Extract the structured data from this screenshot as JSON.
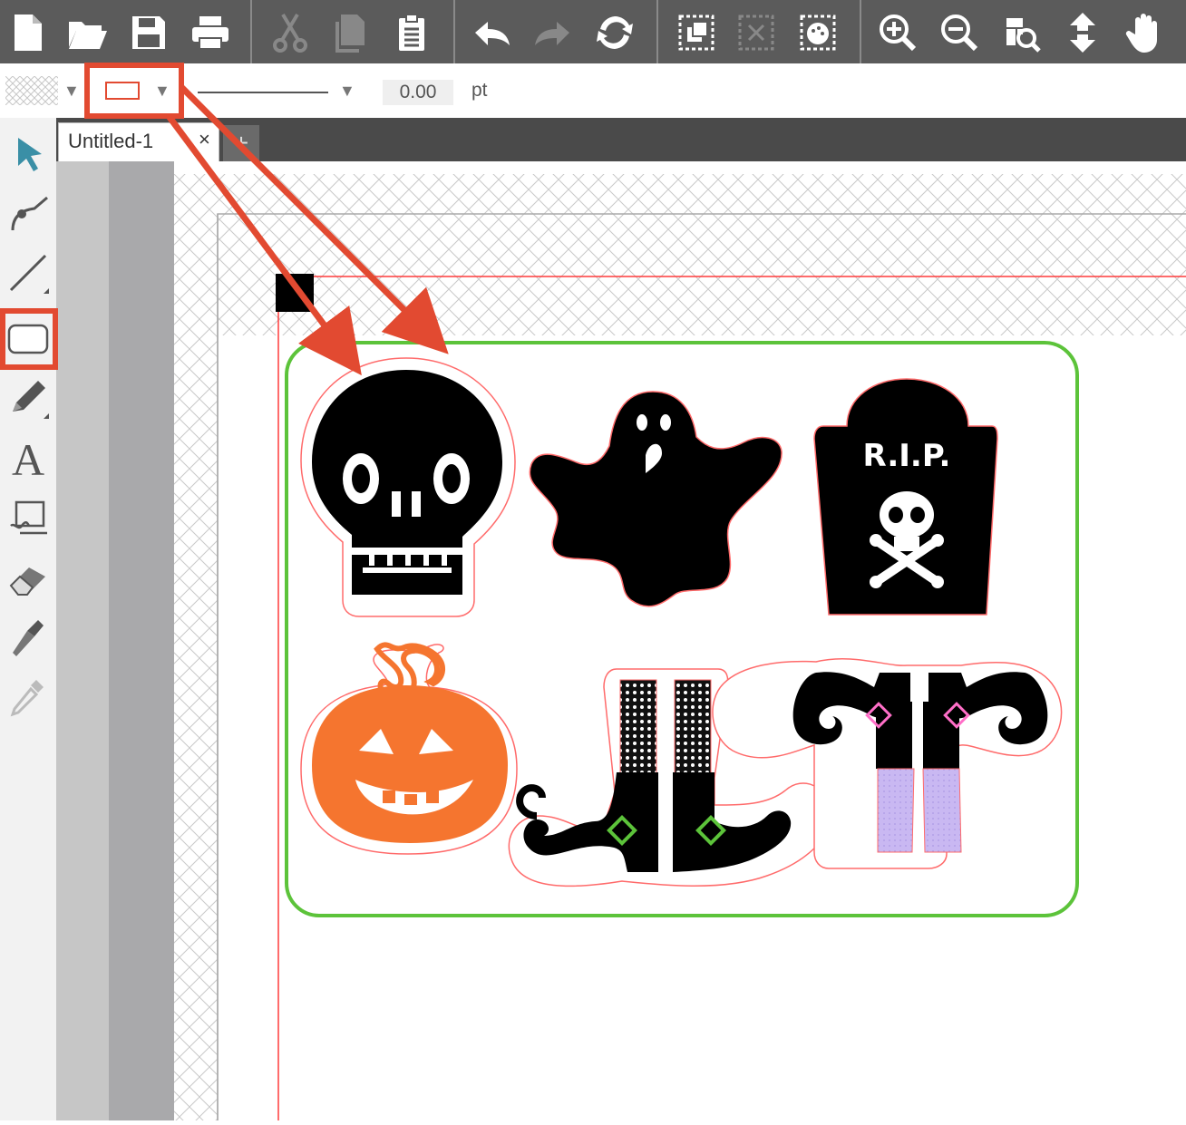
{
  "document": {
    "tab_title": "Untitled-1",
    "tab_close": "×",
    "tab_add": "+"
  },
  "toolbar": {
    "groups": [
      [
        "new-document-icon",
        "open-folder-icon",
        "save-icon",
        "print-icon"
      ],
      [
        "cut-icon",
        "copy-icon",
        "paste-icon"
      ],
      [
        "undo-icon",
        "redo-icon",
        "refresh-icon"
      ],
      [
        "group-icon",
        "ungroup-icon",
        "replicate-icon"
      ],
      [
        "zoom-in-icon",
        "zoom-out-icon",
        "zoom-fit-icon",
        "move-icon",
        "pan-hand-icon"
      ]
    ]
  },
  "properties": {
    "line_width": "0.00",
    "unit": "pt"
  },
  "tools": [
    "select-arrow-icon",
    "edit-points-icon",
    "line-tool-icon",
    "rectangle-tool-icon",
    "pencil-icon",
    "text-tool-icon",
    "sketch-icon",
    "eraser-icon",
    "knife-icon",
    "eyedropper-icon"
  ],
  "canvas": {
    "rip_text": "R.I.P.",
    "colors": {
      "cut_border": "#5cc33a",
      "registration": "#ff3b3b",
      "pumpkin": "#f5752f",
      "callout": "#e24a31",
      "witch_stripe": "#c9b8f2"
    },
    "shapes": [
      "skull",
      "ghost",
      "tombstone",
      "pumpkin",
      "witch-boots",
      "witch-legs"
    ]
  }
}
